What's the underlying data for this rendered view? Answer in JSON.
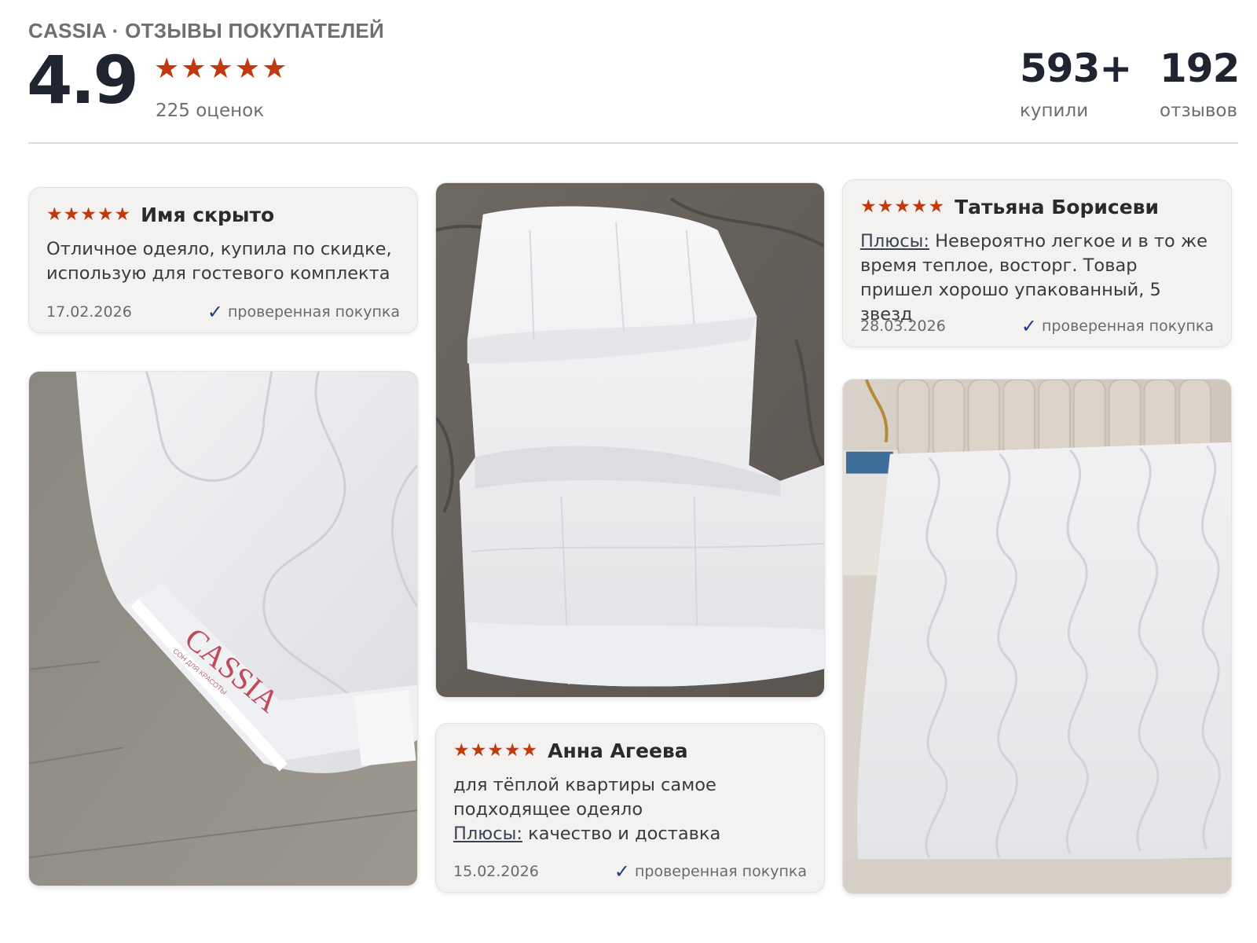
{
  "header": {
    "brand_title": "CASSIA · ОТЗЫВЫ ПОКУПАТЕЛЕЙ",
    "rating": "4.9",
    "stars": "★★★★★",
    "ratings_count": "225 оценок",
    "bought_value": "593+",
    "bought_label": "купили",
    "reviews_value": "192",
    "reviews_label": "отзывов"
  },
  "colors": {
    "star": "#c0390f",
    "check": "#1e3a8a",
    "card_bg": "#f3f2f0"
  },
  "reviews": [
    {
      "stars": "★★★★★",
      "name": "Имя скрыто",
      "text": "Отличное одеяло, купила по скидке, использую для гостевого комплекта",
      "date": "17.02.2026",
      "verified": "проверенная покупка"
    },
    {
      "stars": "★★★★★",
      "name": "Татьяна Борисеви",
      "plus_label": "Плюсы:",
      "text": " Невероятно легкое и в то же время теплое, восторг. Товар пришел хорошо упакованный, 5 звезд",
      "date": "28.03.2026",
      "verified": "проверенная покупка"
    },
    {
      "stars": "★★★★★",
      "name": "Анна Агеева",
      "text": "для тёплой квартиры самое подходящее одеяло",
      "plus_label": "Плюсы:",
      "plus_text": " качество и доставка",
      "date": "15.02.2026",
      "verified": "проверенная покупка"
    }
  ],
  "photos": {
    "label_brand": "CASSIA",
    "label_tagline": "СОН ДЛЯ КРАСОТЫ"
  }
}
